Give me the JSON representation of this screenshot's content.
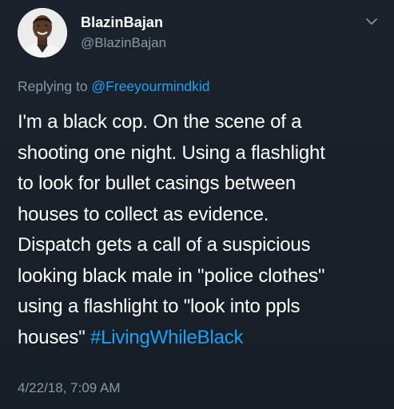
{
  "user": {
    "display_name": "BlazinBajan",
    "handle": "@BlazinBajan"
  },
  "reply": {
    "prefix": "Replying to ",
    "mention": "@Freeyourmindkid"
  },
  "tweet": {
    "lines": [
      "I'm a black cop. On the scene of a",
      "shooting one night. Using a flashlight",
      "to look for bullet casings between",
      "houses to collect as evidence.",
      "Dispatch gets a call of a suspicious",
      "looking black male in \"police clothes\"",
      "using a flashlight to \"look into ppls",
      "houses\" "
    ],
    "hashtag": "#LivingWhileBlack"
  },
  "timestamp": "4/22/18, 7:09 AM",
  "icons": {
    "menu": "chevron-down-icon",
    "avatar": "avatar"
  },
  "colors": {
    "background": "#1a222c",
    "link": "#1da1f2",
    "secondary_text": "#8899a6",
    "primary_text": "#ffffff"
  }
}
